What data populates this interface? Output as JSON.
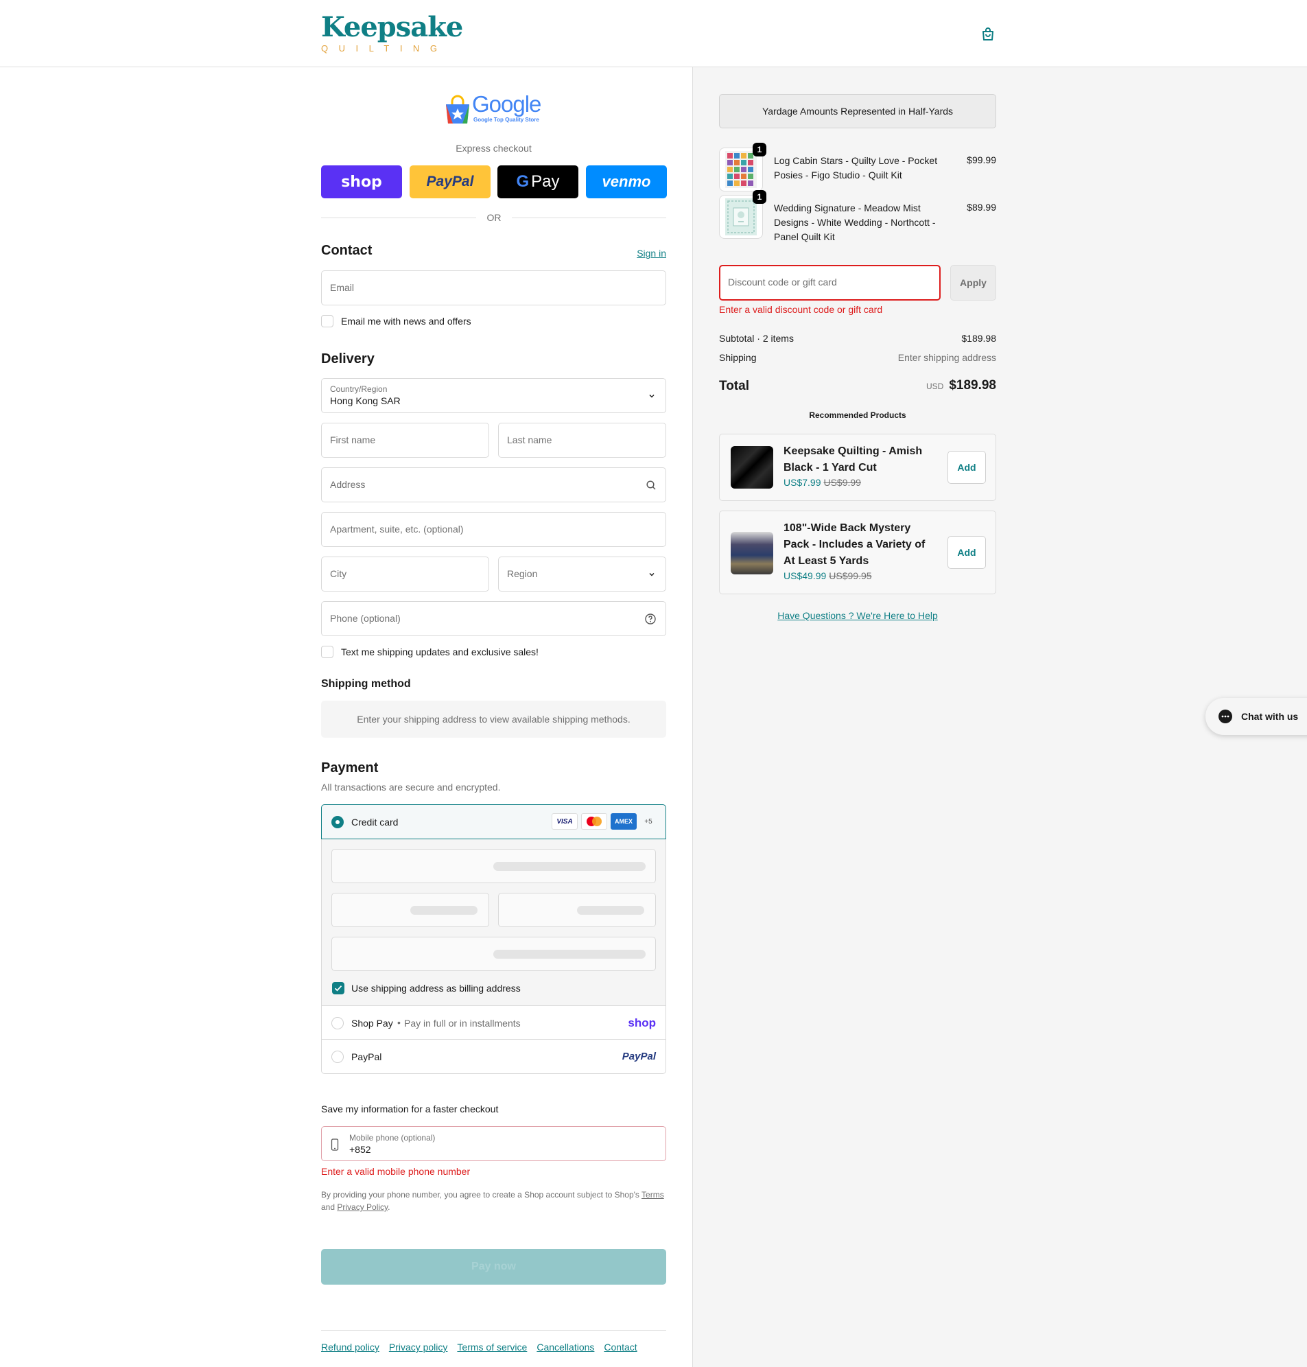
{
  "header": {
    "logo_main": "Keepsake",
    "logo_sub": "QUILTING"
  },
  "express": {
    "store_badge_text": "Google",
    "store_badge_sub": "Google Top Quality Store",
    "title": "Express checkout",
    "shop_label": "shop",
    "paypal_label": "PayPal",
    "gpay_label": "Pay",
    "venmo_label": "venmo",
    "or_label": "OR"
  },
  "contact": {
    "title": "Contact",
    "sign_in": "Sign in",
    "email_placeholder": "Email",
    "newsletter_label": "Email me with news and offers"
  },
  "delivery": {
    "title": "Delivery",
    "country_label": "Country/Region",
    "country_value": "Hong Kong SAR",
    "first_name": "First name",
    "last_name": "Last name",
    "address": "Address",
    "apartment": "Apartment, suite, etc. (optional)",
    "city": "City",
    "region": "Region",
    "phone": "Phone (optional)",
    "sms_label": "Text me shipping updates and exclusive sales!"
  },
  "shipping_method": {
    "title": "Shipping method",
    "notice": "Enter your shipping address to view available shipping methods."
  },
  "payment": {
    "title": "Payment",
    "subtitle": "All transactions are secure and encrypted.",
    "credit_card_label": "Credit card",
    "visa": "VISA",
    "amex": "AMEX",
    "more_cards": "+5",
    "billing_label": "Use shipping address as billing address",
    "shop_pay_label": "Shop Pay",
    "shop_pay_sub": "Pay in full or in installments",
    "shop_pay_logo": "shop",
    "paypal_label": "PayPal",
    "paypal_logo": "PayPal"
  },
  "save_info": {
    "title": "Save my information for a faster checkout",
    "phone_label": "Mobile phone (optional)",
    "phone_value": "+852",
    "error": "Enter a valid mobile phone number",
    "legal_prefix": "By providing your phone number, you agree to create a Shop account subject to Shop's",
    "terms": "Terms",
    "legal_and": "and",
    "privacy": "Privacy Policy",
    "legal_end": "."
  },
  "pay_now": "Pay now",
  "footer": {
    "links": [
      "Refund policy",
      "Privacy policy",
      "Terms of service",
      "Cancellations",
      "Contact"
    ]
  },
  "summary": {
    "banner": "Yardage Amounts Represented in Half-Yards",
    "items": [
      {
        "name": "Log Cabin Stars - Quilty Love - Pocket Posies - Figo Studio - Quilt Kit",
        "price": "$99.99",
        "qty": "1"
      },
      {
        "name": "Wedding Signature - Meadow Mist Designs - White Wedding - Northcott - Panel Quilt Kit",
        "price": "$89.99",
        "qty": "1"
      }
    ],
    "discount_placeholder": "Discount code or gift card",
    "apply": "Apply",
    "discount_error": "Enter a valid discount code or gift card",
    "subtotal_label": "Subtotal · 2 items",
    "subtotal_value": "$189.98",
    "shipping_label": "Shipping",
    "shipping_value": "Enter shipping address",
    "total_label": "Total",
    "currency": "USD",
    "total_value": "$189.98",
    "recommended_title": "Recommended Products",
    "recommended": [
      {
        "title": "Keepsake Quilting - Amish Black - 1 Yard Cut",
        "price": "US$7.99",
        "was": "US$9.99",
        "add": "Add"
      },
      {
        "title": "108\"-Wide Back Mystery Pack - Includes a Variety of At Least 5 Yards",
        "price": "US$49.99",
        "was": "US$99.95",
        "add": "Add"
      }
    ],
    "help_link": "Have Questions ? We're Here to Help"
  },
  "chat": {
    "label": "Chat with us"
  },
  "colors": {
    "brand_teal": "#0f7f85",
    "brand_gold": "#e2a23b",
    "shop_purple": "#5a31f4",
    "paypal_yellow": "#ffc439",
    "venmo_blue": "#008cff",
    "error_red": "#dd1d1d"
  }
}
